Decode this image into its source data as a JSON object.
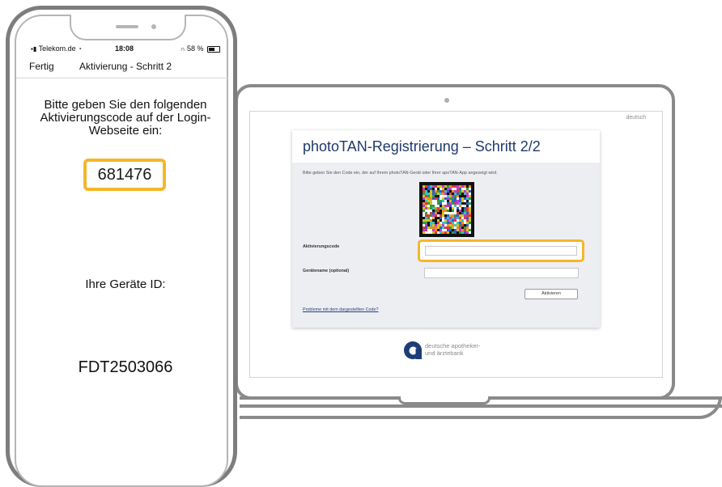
{
  "phone": {
    "status": {
      "carrier": "Telekom.de",
      "time": "18:08",
      "battery": "58 %"
    },
    "nav": {
      "done": "Fertig",
      "title": "Aktivierung - Schritt 2"
    },
    "instruction": "Bitte geben Sie den folgenden Aktivierungscode auf der Login-Webseite ein:",
    "activation_code": "681476",
    "device_label": "Ihre Geräte ID:",
    "device_id": "FDT2503066"
  },
  "laptop": {
    "language_link": "deutsch",
    "card_title": "photoTAN-Registrierung – Schritt 2/2",
    "instruction": "Bitte geben Sie den Code ein, der auf Ihrem photoTAN-Gerät oder Ihrer apoTAN-App angezeigt wird.",
    "activation_code_label": "Aktivierungscode",
    "activation_code_value": "",
    "device_name_label": "Gerätename (optional)",
    "device_name_value": "",
    "activate_button": "Aktivieren",
    "problem_link": "Probleme mit dem dargestellten Code?",
    "bank_name_line1": "deutsche apotheker-",
    "bank_name_line2": "und ärztebank"
  },
  "colors": {
    "highlight": "#f5b62a",
    "title_blue": "#1f3a6b",
    "link_blue": "#2b3f7a",
    "bank_blue": "#1b3d7a"
  },
  "icons": [
    "signal-icon",
    "wifi-icon",
    "headphone-icon",
    "battery-icon",
    "qr-code",
    "bank-logo-icon"
  ]
}
